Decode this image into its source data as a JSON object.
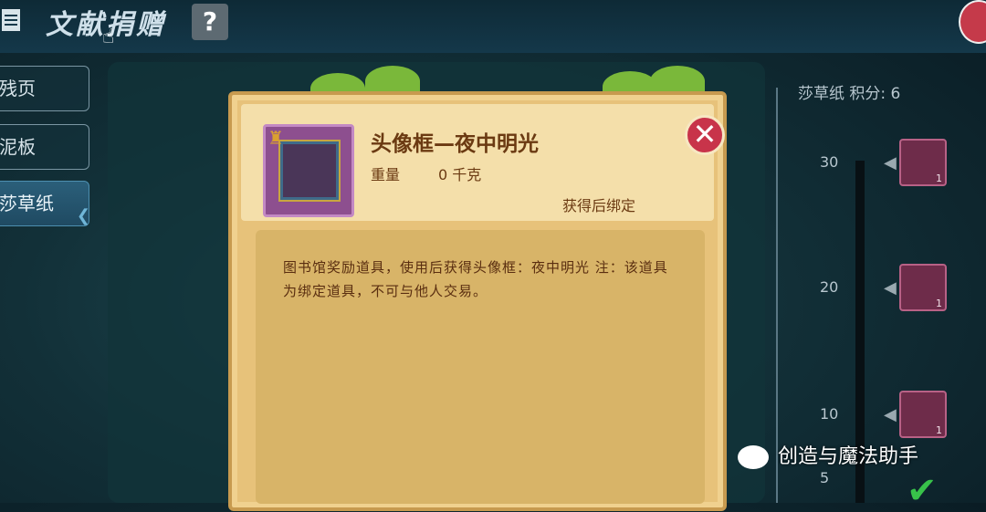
{
  "header": {
    "title": "文献捐赠",
    "help_label": "?"
  },
  "tabs": [
    {
      "label": "残页"
    },
    {
      "label": "泥板"
    },
    {
      "label": "莎草纸"
    }
  ],
  "score_text": "莎草纸 积分: 6",
  "ticks": [
    "30",
    "20",
    "10",
    "5"
  ],
  "reward_counts": [
    "1",
    "1",
    "1"
  ],
  "popup": {
    "item_name": "头像框—夜中明光",
    "weight_label": "重量",
    "weight_value": "0 千克",
    "bind_label": "获得后绑定",
    "close_label": "✕",
    "description": "图书馆奖励道具，使用后获得头像框：夜中明光 注：该道具为绑定道具，不可与他人交易。"
  },
  "watermark": "创造与魔法助手",
  "colors": {
    "popup_bg": "#e7c27a",
    "close_red": "#c8344a",
    "item_text": "#6b3a12",
    "active_tab": "#2b5f7a"
  }
}
